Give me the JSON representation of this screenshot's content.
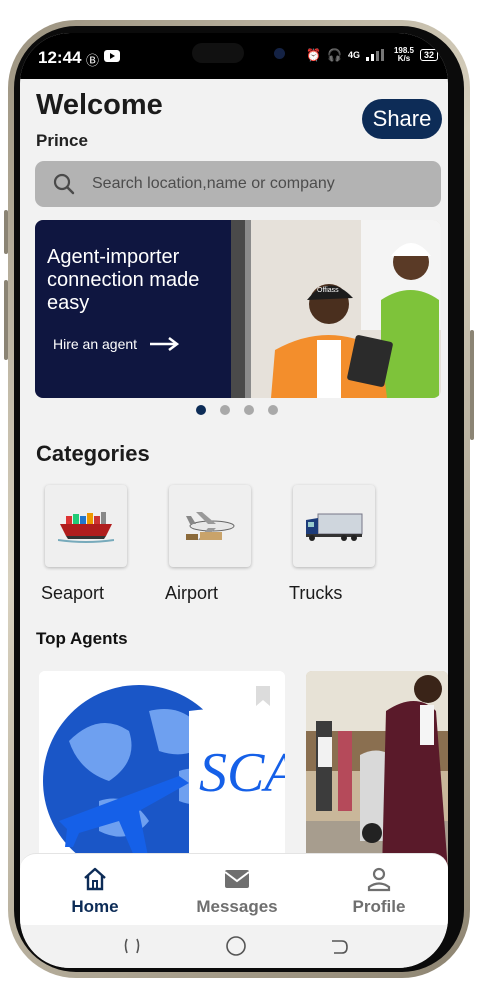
{
  "status_bar": {
    "time": "12:44",
    "network_speed_value": "198.5",
    "network_speed_unit": "K/s",
    "battery": "32",
    "network_label": "4G"
  },
  "header": {
    "title": "Welcome",
    "username": "Prince",
    "share_label": "Share"
  },
  "search": {
    "placeholder": "Search location,name or company"
  },
  "banner": {
    "headline": "Agent-importer connection made easy",
    "cta_label": "Hire an agent",
    "photo_cap_text": "Offiass",
    "background_color": "#0f1640"
  },
  "carousel": {
    "total": 4,
    "active_index": 0
  },
  "categories": {
    "title": "Categories",
    "items": [
      {
        "label": "Seaport",
        "icon": "ship-icon"
      },
      {
        "label": "Airport",
        "icon": "airplane-icon"
      },
      {
        "label": "Trucks",
        "icon": "truck-icon"
      }
    ]
  },
  "top_agents": {
    "title": "Top Agents",
    "cards": [
      {
        "logo_text": "SCA",
        "image": "globe-airplane-logo"
      },
      {
        "image": "agent-photo"
      }
    ]
  },
  "bottom_nav": {
    "items": [
      {
        "label": "Home",
        "icon": "home-icon",
        "active": true
      },
      {
        "label": "Messages",
        "icon": "mail-icon",
        "active": false
      },
      {
        "label": "Profile",
        "icon": "person-icon",
        "active": false
      }
    ]
  },
  "colors": {
    "accent": "#0d2c57",
    "search_bg": "#b3b3b3",
    "screen_bg": "#f2f2f2"
  }
}
